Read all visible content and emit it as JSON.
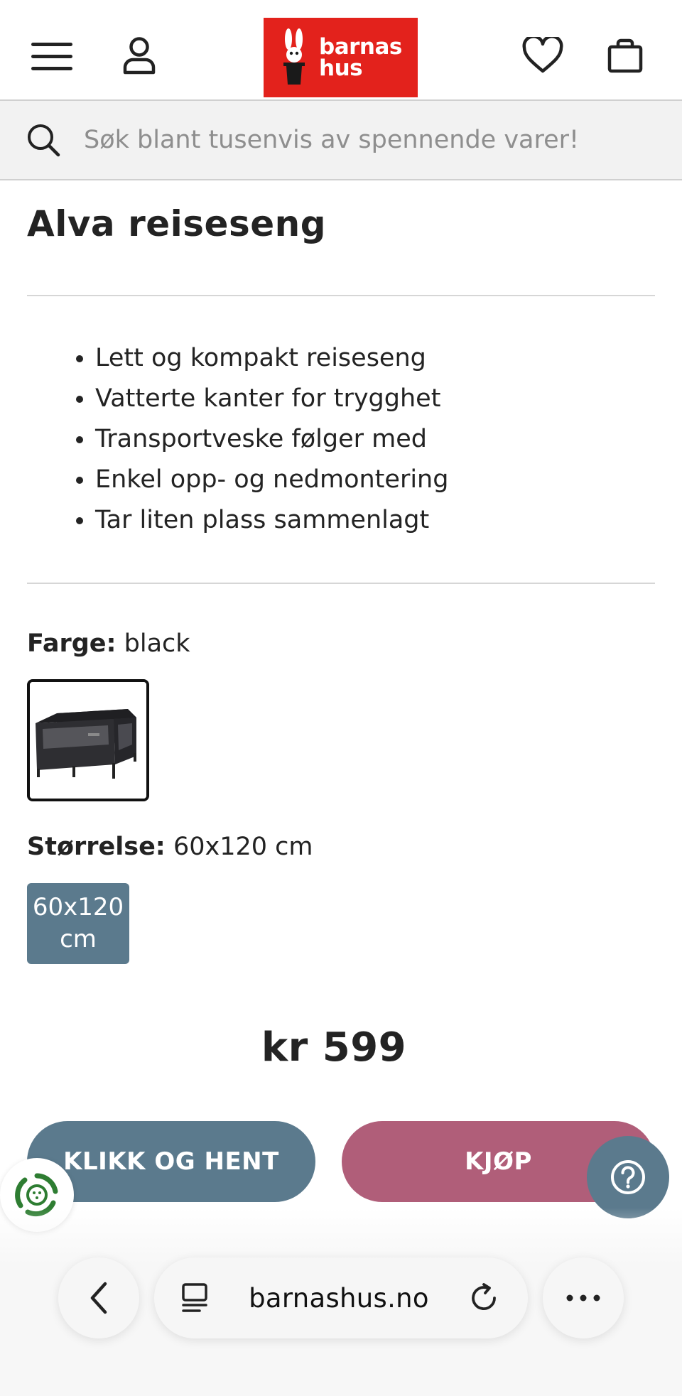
{
  "header": {
    "menu_icon": "hamburger-menu-icon",
    "account_icon": "user-icon",
    "logo_text_line1": "barnas",
    "logo_text_line2": "hus",
    "wishlist_icon": "heart-icon",
    "cart_icon": "shopping-bag-icon",
    "brand_color": "#e3221c"
  },
  "search": {
    "placeholder": "Søk blant tusenvis av spennende varer!",
    "icon": "search-icon"
  },
  "product": {
    "title": "Alva reiseseng",
    "features": [
      "Lett og kompakt reiseseng",
      "Vatterte kanter for trygghet",
      "Transportveske følger med",
      "Enkel opp- og nedmontering",
      "Tar liten plass sammenlagt"
    ],
    "color_label": "Farge:",
    "color_value": "black",
    "size_label": "Størrelse:",
    "size_value": "60x120 cm",
    "size_option": "60x120 cm",
    "price": "kr 599"
  },
  "actions": {
    "click_collect_label": "KLIKK OG HENT",
    "buy_label": "KJØP",
    "click_collect_color": "#5b7a8d",
    "buy_color": "#b05e79"
  },
  "browser": {
    "url": "barnashus.no",
    "back_icon": "chevron-left-icon",
    "tabs_icon": "tabs-icon",
    "reload_icon": "reload-icon",
    "more_icon": "more-dots-icon"
  }
}
